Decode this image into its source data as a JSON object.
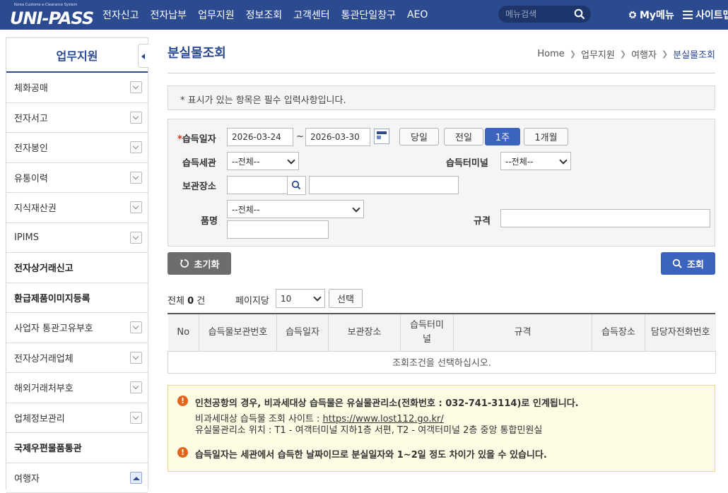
{
  "header": {
    "logo_tagline": "Korea Customs e-Clearance System",
    "logo_text": "UNI-PASS",
    "nav": [
      "전자신고",
      "전자납부",
      "업무지원",
      "정보조회",
      "고객센터",
      "통관단일창구",
      "AEO"
    ],
    "search_placeholder": "메뉴검색",
    "my_menu": "My메뉴",
    "sitemap": "사이트맵"
  },
  "sidebar": {
    "title": "업무지원",
    "items": [
      {
        "label": "체화공매",
        "expandable": true
      },
      {
        "label": "전자서고",
        "expandable": true
      },
      {
        "label": "전자봉인",
        "expandable": true
      },
      {
        "label": "유통이력",
        "expandable": true
      },
      {
        "label": "지식재산권",
        "expandable": true
      },
      {
        "label": "IPIMS",
        "expandable": true
      },
      {
        "label": "전자상거래신고",
        "expandable": false
      },
      {
        "label": "환급제품이미지등록",
        "expandable": false
      },
      {
        "label": "사업자 통관고유부호",
        "expandable": true
      },
      {
        "label": "전자상거래업체",
        "expandable": true
      },
      {
        "label": "해외거래처부호",
        "expandable": true
      },
      {
        "label": "업체정보관리",
        "expandable": true
      },
      {
        "label": "국제우편물품통관",
        "expandable": false
      },
      {
        "label": "여행자",
        "expandable": true,
        "open": true
      }
    ]
  },
  "page": {
    "title": "분실물조회",
    "breadcrumb": [
      "Home",
      "업무지원",
      "여행자",
      "분실물조회"
    ]
  },
  "notice": "* 표시가 있는 항목은 필수 입력사항입니다.",
  "form": {
    "date_label_req": "*",
    "date_label": "습득일자",
    "date_from": "2026-03-24",
    "date_sep": "~",
    "date_to": "2026-03-30",
    "period_buttons": [
      "당일",
      "전일",
      "1주",
      "1개월"
    ],
    "period_active": "1주",
    "customs_label": "습득세관",
    "customs_value": "--전체--",
    "terminal_label": "습득터미널",
    "terminal_value": "--전체--",
    "storage_label": "보관장소",
    "storage_code": "",
    "storage_name": "",
    "item_label": "품명",
    "item_value": "--전체--",
    "item_text": "",
    "spec_label": "규격",
    "spec_value": ""
  },
  "actions": {
    "reset": "초기화",
    "search": "조회"
  },
  "results": {
    "total_prefix": "전체",
    "total_count": "0",
    "total_suffix": "건",
    "per_page_label": "페이지당",
    "per_page_value": "10",
    "choose": "선택",
    "columns": [
      "No",
      "습득물보관번호",
      "습득일자",
      "보관장소",
      "습득터미\n널",
      "규격",
      "습득장소",
      "담당자전화번호"
    ],
    "empty_message": "조회조건을 선택하십시오."
  },
  "info": {
    "line1": "인천공항의 경우, 비과세대상 습득물은 유실물관리소(전화번호 : 032-741-3114)로 인계됩니다.",
    "line2_prefix": "비과세대상 습득물 조회 사이트 : ",
    "line2_link": "https://www.lost112.go.kr/",
    "line3": "유실물관리소 위치 : T1 - 여객터미널 지하1층 서편, T2 - 여객터미널 2층 중앙 통합민원실",
    "line4": "습득일자는 세관에서 습득한 날짜이므로 분실일자와 1~2일 정도 차이가 있을 수 있습니다.",
    "icon_glyph": "!"
  },
  "colors": {
    "brand": "#2b4a8f",
    "accent": "#3c63bd",
    "required": "#d8341e",
    "warning": "#e0661b"
  }
}
